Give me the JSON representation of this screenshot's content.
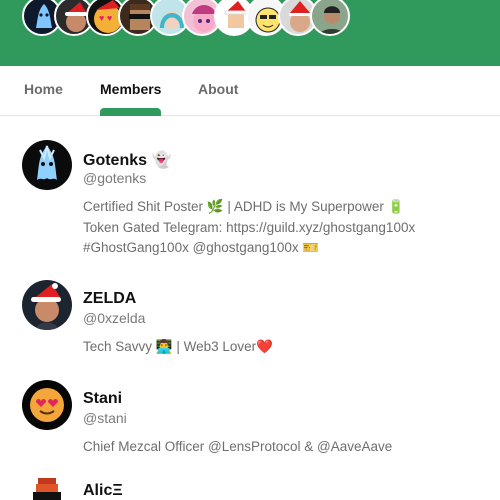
{
  "header": {
    "band_color": "#2f9a5c",
    "avatars": [
      {
        "name": "ghost-avatar",
        "bg": "#0e1a2b"
      },
      {
        "name": "santa-man-avatar",
        "bg": "#2b2b2b"
      },
      {
        "name": "heart-eyes-avatar",
        "bg": "#111111"
      },
      {
        "name": "pixel-glasses-avatar",
        "bg": "#3d2a1d"
      },
      {
        "name": "blue-hair-avatar",
        "bg": "#bfe4ea"
      },
      {
        "name": "pink-pony-avatar",
        "bg": "#f3c1d6"
      },
      {
        "name": "santa-pixel-avatar",
        "bg": "#ffffff"
      },
      {
        "name": "cartoon-face-avatar",
        "bg": "#f6f6f6"
      },
      {
        "name": "santa-person-avatar",
        "bg": "#d9d9d9"
      },
      {
        "name": "man-portrait-avatar",
        "bg": "#8aa58a"
      }
    ]
  },
  "tabs": [
    {
      "label": "Home",
      "active": false
    },
    {
      "label": "Members",
      "active": true
    },
    {
      "label": "About",
      "active": false
    }
  ],
  "members": [
    {
      "name": "Gotenks 👻",
      "handle": "@gotenks",
      "bio": [
        "Certified Shit Poster 🌿  | ADHD is My Superpower 🔋",
        "Token Gated Telegram: https://guild.xyz/ghostgang100x",
        "#GhostGang100x @ghostgang100x 🎫"
      ]
    },
    {
      "name": "ZELDA",
      "handle": "@0xzelda",
      "bio": [
        "Tech Savvy 👨‍💻  | Web3 Lover❤️"
      ]
    },
    {
      "name": "Stani",
      "handle": "@stani",
      "bio": [
        "Chief Mezcal Officer @LensProtocol & @AaveAave"
      ]
    },
    {
      "name": "AlicΞ",
      "handle": "",
      "bio": []
    }
  ]
}
